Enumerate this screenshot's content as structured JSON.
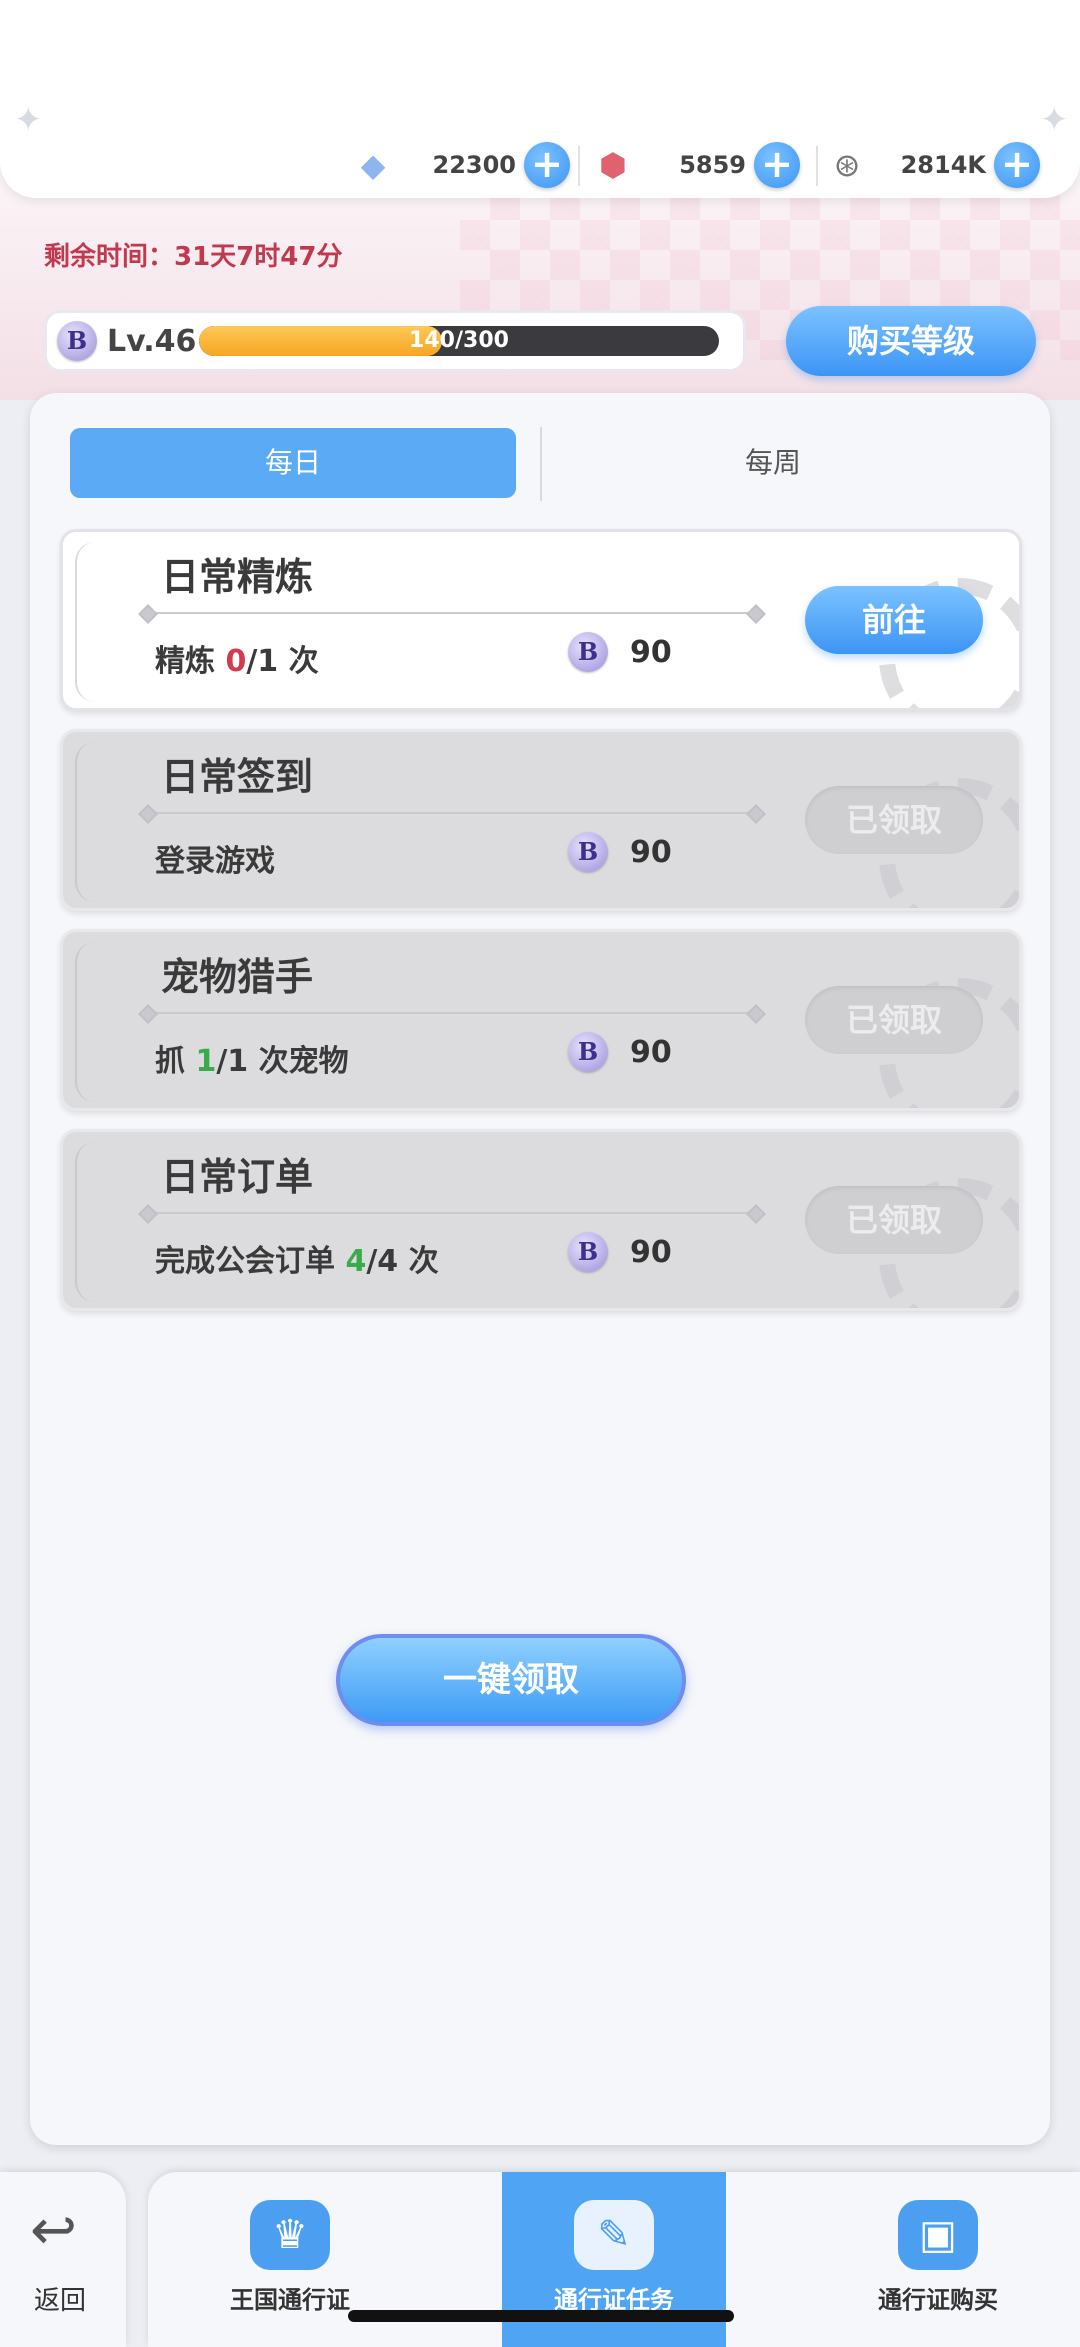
{
  "currencies": [
    {
      "icon": "diamond-icon",
      "value": "22300"
    },
    {
      "icon": "red-crystal-icon",
      "value": "5859"
    },
    {
      "icon": "gray-coin-icon",
      "value": "2814K"
    }
  ],
  "remaining_time": "剩余时间：31天7时47分",
  "level": {
    "label": "Lv.46",
    "progress_text": "140/300",
    "progress_current": 140,
    "progress_max": 300
  },
  "buy_level_label": "购买等级",
  "tabs": [
    {
      "label": "每日",
      "active": true
    },
    {
      "label": "每周",
      "active": false
    }
  ],
  "tasks": [
    {
      "title": "日常精炼",
      "desc_pre": "精炼 ",
      "desc_num": "0",
      "desc_post": "/1 次",
      "num_color": "red",
      "reward": "90",
      "button": "前往",
      "state": "active"
    },
    {
      "title": "日常签到",
      "desc_pre": "登录游戏",
      "desc_num": "",
      "desc_post": "",
      "num_color": "",
      "reward": "90",
      "button": "已领取",
      "state": "done"
    },
    {
      "title": "宠物猎手",
      "desc_pre": "抓 ",
      "desc_num": "1",
      "desc_post": "/1 次宠物",
      "num_color": "green",
      "reward": "90",
      "button": "已领取",
      "state": "done"
    },
    {
      "title": "日常订单",
      "desc_pre": "完成公会订单 ",
      "desc_num": "4",
      "desc_post": "/4 次",
      "num_color": "green",
      "reward": "90",
      "button": "已领取",
      "state": "done"
    }
  ],
  "claim_all_label": "一键领取",
  "nav": {
    "back_label": "返回",
    "items": [
      {
        "label": "王国通行证",
        "icon": "crown-slime-icon",
        "active": false
      },
      {
        "label": "通行证任务",
        "icon": "scroll-icon",
        "active": true
      },
      {
        "label": "通行证购买",
        "icon": "wallet-icon",
        "active": false
      }
    ]
  },
  "colors": {
    "accent_blue": "#3c95f5",
    "time_red": "#c0394e",
    "progress_orange": "#f5a623",
    "progress_red": "#d33a4d",
    "progress_green": "#3aab4a"
  }
}
